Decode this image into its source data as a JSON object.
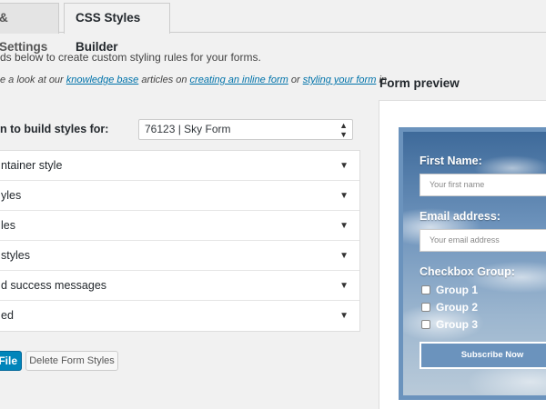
{
  "tabs": [
    {
      "label": "& Settings"
    },
    {
      "label": "CSS Styles Builder"
    }
  ],
  "intro": {
    "line1": "ds below to create custom styling rules for your forms.",
    "line2_a": "e a look at our ",
    "link_kb": "knowledge base",
    "line2_b": " articles on ",
    "link_inline": "creating an inline form",
    "line2_c": " or ",
    "link_styling": "styling your form",
    "line2_d": " in"
  },
  "build": {
    "label": "n to build styles for:",
    "selected_form": "76123 | Sky Form"
  },
  "accordion": [
    {
      "label": "ntainer style"
    },
    {
      "label": "yles"
    },
    {
      "label": "les"
    },
    {
      "label": "styles"
    },
    {
      "label": "d success messages"
    },
    {
      "label": "ed"
    }
  ],
  "buttons": {
    "save_label": "File",
    "delete_label": "Delete Form Styles"
  },
  "preview": {
    "title": "Form preview",
    "first_name_label": "First Name:",
    "first_name_placeholder": "Your first name",
    "email_label": "Email address:",
    "email_placeholder": "Your email address",
    "checkbox_group_label": "Checkbox Group:",
    "checkboxes": [
      {
        "label": "Group 1"
      },
      {
        "label": "Group 2"
      },
      {
        "label": "Group 3"
      }
    ],
    "subscribe_label": "Subscribe Now"
  },
  "colors": {
    "primary_button": "#0085ba",
    "link": "#0073aa",
    "form_border": "#6b93bd"
  }
}
